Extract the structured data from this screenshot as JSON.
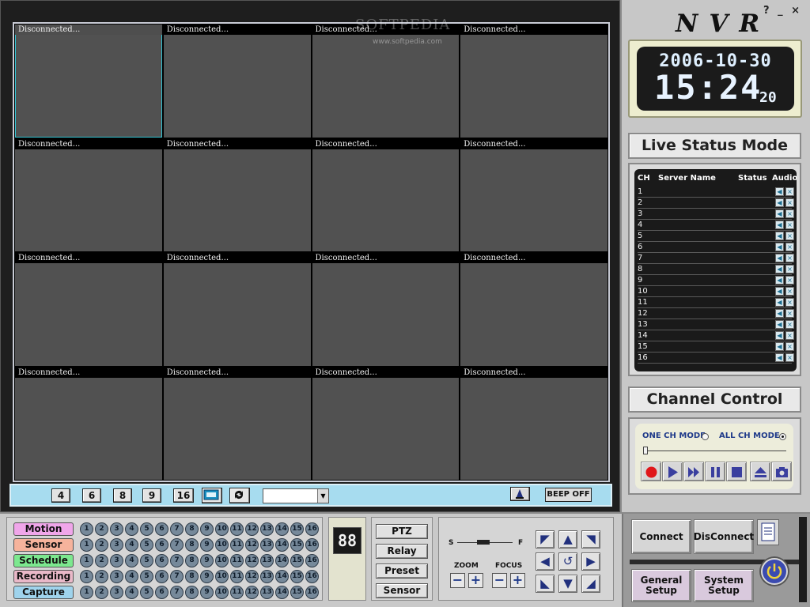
{
  "watermark": {
    "main": "SOFTPEDIA",
    "url": "www.softpedia.com"
  },
  "channels": [
    {
      "caption": "Disconnected..."
    },
    {
      "caption": "Disconnected..."
    },
    {
      "caption": "Disconnected..."
    },
    {
      "caption": "Disconnected..."
    },
    {
      "caption": "Disconnected..."
    },
    {
      "caption": "Disconnected..."
    },
    {
      "caption": "Disconnected..."
    },
    {
      "caption": "Disconnected..."
    },
    {
      "caption": "Disconnected..."
    },
    {
      "caption": "Disconnected..."
    },
    {
      "caption": "Disconnected..."
    },
    {
      "caption": "Disconnected..."
    },
    {
      "caption": "Disconnected..."
    },
    {
      "caption": "Disconnected..."
    },
    {
      "caption": "Disconnected..."
    },
    {
      "caption": "Disconnected..."
    }
  ],
  "layout_bar": {
    "split_buttons": [
      "4",
      "6",
      "8",
      "9",
      "16"
    ],
    "fullscreen_icon": "fullscreen-icon",
    "cycle_icon": "refresh-icon",
    "combo_value": "",
    "alarm_icon": "bell-icon",
    "beep_label": "BEEP OFF"
  },
  "window_controls": "? _ ×",
  "app_title": "NVR",
  "clock": {
    "date": "2006-10-30",
    "time": "15:24",
    "seconds": "20"
  },
  "live_status": {
    "title": "Live Status Mode",
    "headers": {
      "ch": "CH",
      "server": "Server Name",
      "status": "Status",
      "audio": "Audio"
    },
    "rows": [
      "1",
      "2",
      "3",
      "4",
      "5",
      "6",
      "7",
      "8",
      "9",
      "10",
      "11",
      "12",
      "13",
      "14",
      "15",
      "16"
    ]
  },
  "channel_control": {
    "title": "Channel Control",
    "one_ch_mode": "ONE CH MODE",
    "all_ch_mode": "ALL CH MODE",
    "selected_mode": "all",
    "buttons": [
      "record-icon",
      "play-icon",
      "fast-forward-icon",
      "pause-icon",
      "stop-icon",
      "eject-icon",
      "snapshot-icon"
    ]
  },
  "record_panel": {
    "categories": [
      {
        "label": "Motion",
        "color": "#f0a6ea"
      },
      {
        "label": "Sensor",
        "color": "#f6b39c"
      },
      {
        "label": "Schedule",
        "color": "#7ce88f"
      },
      {
        "label": "Recording",
        "color": "#e9b8c8"
      },
      {
        "label": "Capture",
        "color": "#9fd3ec"
      }
    ],
    "channel_numbers": [
      "1",
      "2",
      "3",
      "4",
      "5",
      "6",
      "7",
      "8",
      "9",
      "10",
      "11",
      "12",
      "13",
      "14",
      "15",
      "16"
    ]
  },
  "segment_display": "88",
  "ptz_column": [
    "PTZ",
    "Relay",
    "Preset",
    "Sensor"
  ],
  "ptz_pad": {
    "slow_label": "S",
    "fast_label": "F",
    "zoom_label": "ZOOM",
    "focus_label": "FOCUS",
    "minus": "−",
    "plus": "+"
  },
  "bottom_right": {
    "connect": "Connect",
    "disconnect": "DisConnect",
    "general_setup": "General Setup",
    "system_setup": "System Setup"
  }
}
